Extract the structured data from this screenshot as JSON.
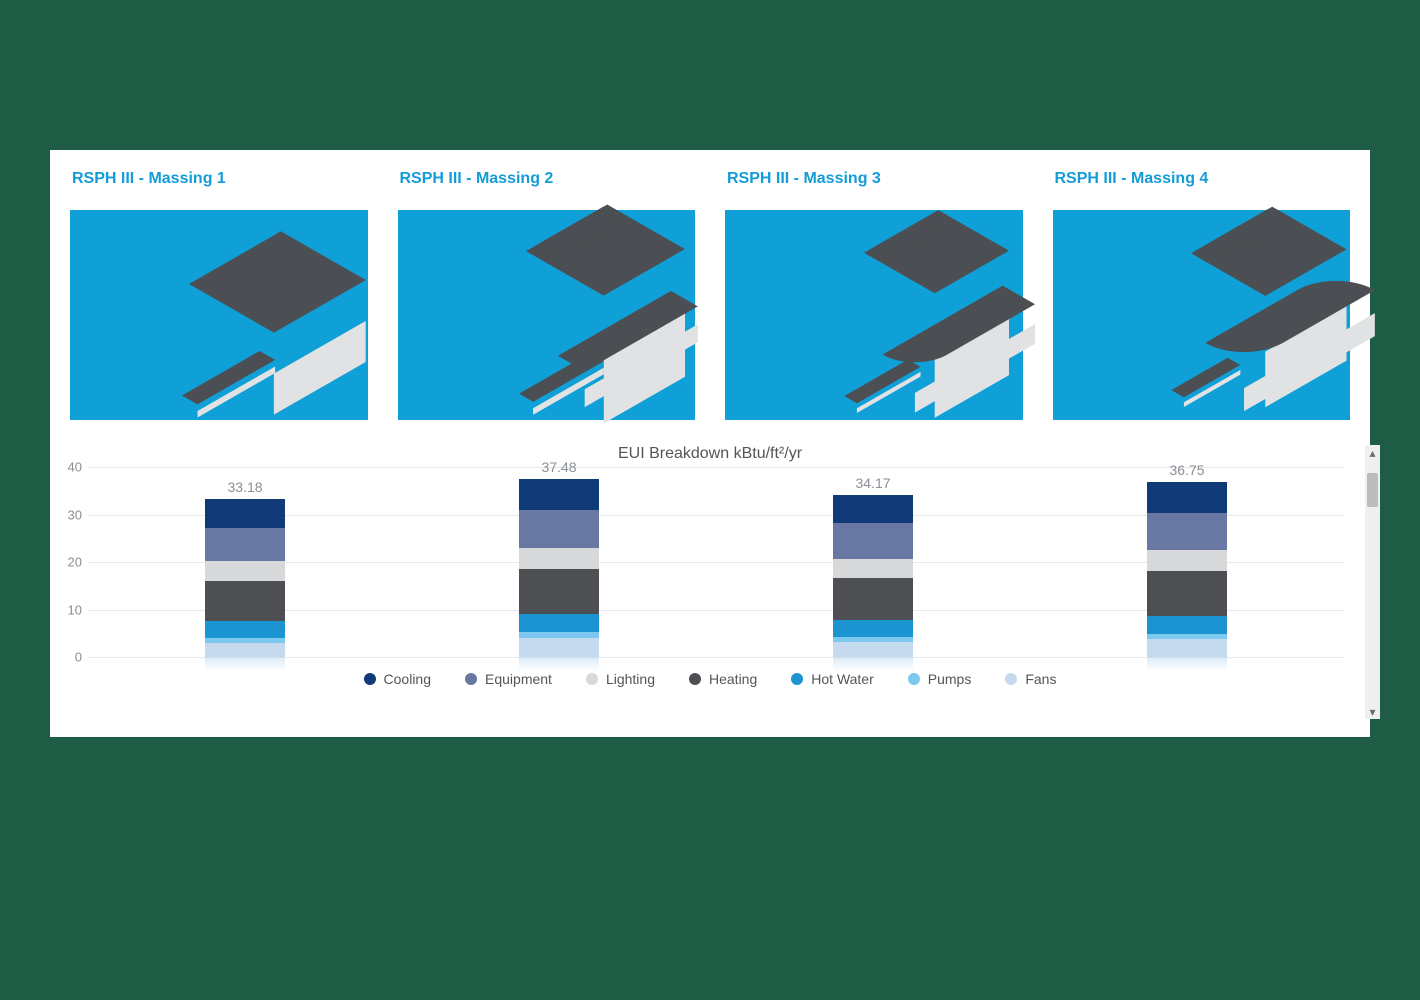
{
  "massings": [
    {
      "title": "RSPH III - Massing 1"
    },
    {
      "title": "RSPH III - Massing 2"
    },
    {
      "title": "RSPH III - Massing 3"
    },
    {
      "title": "RSPH III - Massing 4"
    }
  ],
  "colors": {
    "cooling": "#113a78",
    "equipment": "#6878a3",
    "lighting": "#d6d8da",
    "heating": "#4d4f53",
    "hotwater": "#1c94d2",
    "pumps": "#7cc8ef",
    "fans": "#c5d9ef"
  },
  "chart_data": {
    "type": "bar",
    "title": "EUI Breakdown kBtu/ft²/yr",
    "ylabel": "",
    "xlabel": "",
    "ylim": [
      0,
      40
    ],
    "yticks": [
      0,
      10,
      20,
      30,
      40
    ],
    "categories": [
      "RSPH III - Massing 1",
      "RSPH III - Massing 2",
      "RSPH III - Massing 3",
      "RSPH III - Massing 4"
    ],
    "totals": [
      33.18,
      37.48,
      34.17,
      36.75
    ],
    "series": [
      {
        "name": "Fans",
        "color_key": "fans",
        "values": [
          3.0,
          4.0,
          3.2,
          3.7
        ]
      },
      {
        "name": "Pumps",
        "color_key": "pumps",
        "values": [
          1.0,
          1.2,
          1.0,
          1.1
        ]
      },
      {
        "name": "Hot Water",
        "color_key": "hotwater",
        "values": [
          3.5,
          3.8,
          3.5,
          3.8
        ]
      },
      {
        "name": "Heating",
        "color_key": "heating",
        "values": [
          8.5,
          9.5,
          9.0,
          9.5
        ]
      },
      {
        "name": "Lighting",
        "color_key": "lighting",
        "values": [
          4.2,
          4.5,
          4.0,
          4.5
        ]
      },
      {
        "name": "Equipment",
        "color_key": "equipment",
        "values": [
          7.0,
          8.0,
          7.5,
          7.7
        ]
      },
      {
        "name": "Cooling",
        "color_key": "cooling",
        "values": [
          5.98,
          6.48,
          5.97,
          6.45
        ]
      }
    ],
    "legend_order": [
      "Cooling",
      "Equipment",
      "Lighting",
      "Heating",
      "Hot Water",
      "Pumps",
      "Fans"
    ]
  }
}
